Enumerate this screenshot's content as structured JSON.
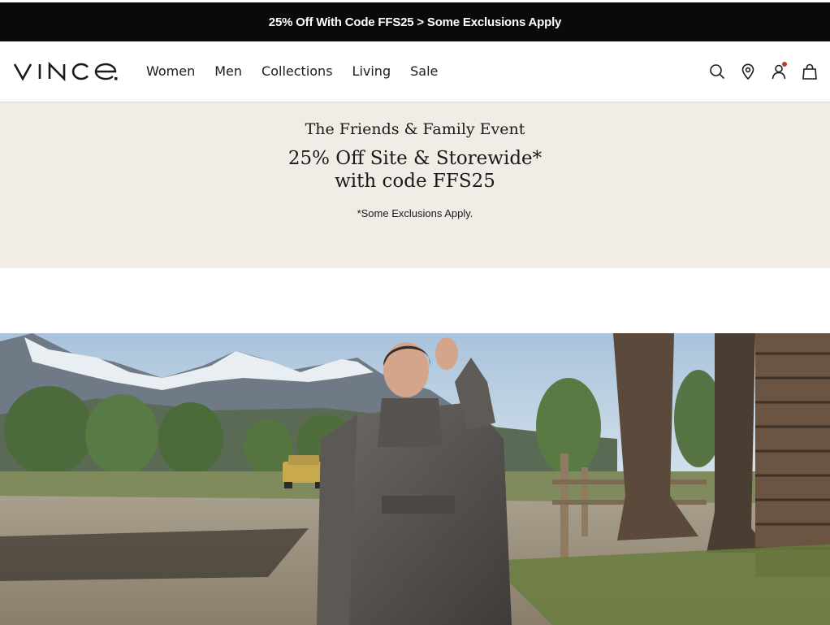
{
  "promo": {
    "text": "25% Off With Code FFS25 > Some Exclusions Apply"
  },
  "header": {
    "logo_text": "VINCE.",
    "nav": [
      "Women",
      "Men",
      "Collections",
      "Living",
      "Sale"
    ],
    "icons": [
      "search-icon",
      "store-locator-icon",
      "account-icon",
      "bag-icon"
    ]
  },
  "event": {
    "title": "The Friends & Family Event",
    "offer_line1": "25% Off Site & Storewide*",
    "offer_line2": "with code FFS25",
    "note": "*Some Exclusions Apply."
  },
  "colors": {
    "promo_bg": "#0a0a0a",
    "event_bg": "#f1ede6",
    "account_badge": "#c0392b"
  }
}
